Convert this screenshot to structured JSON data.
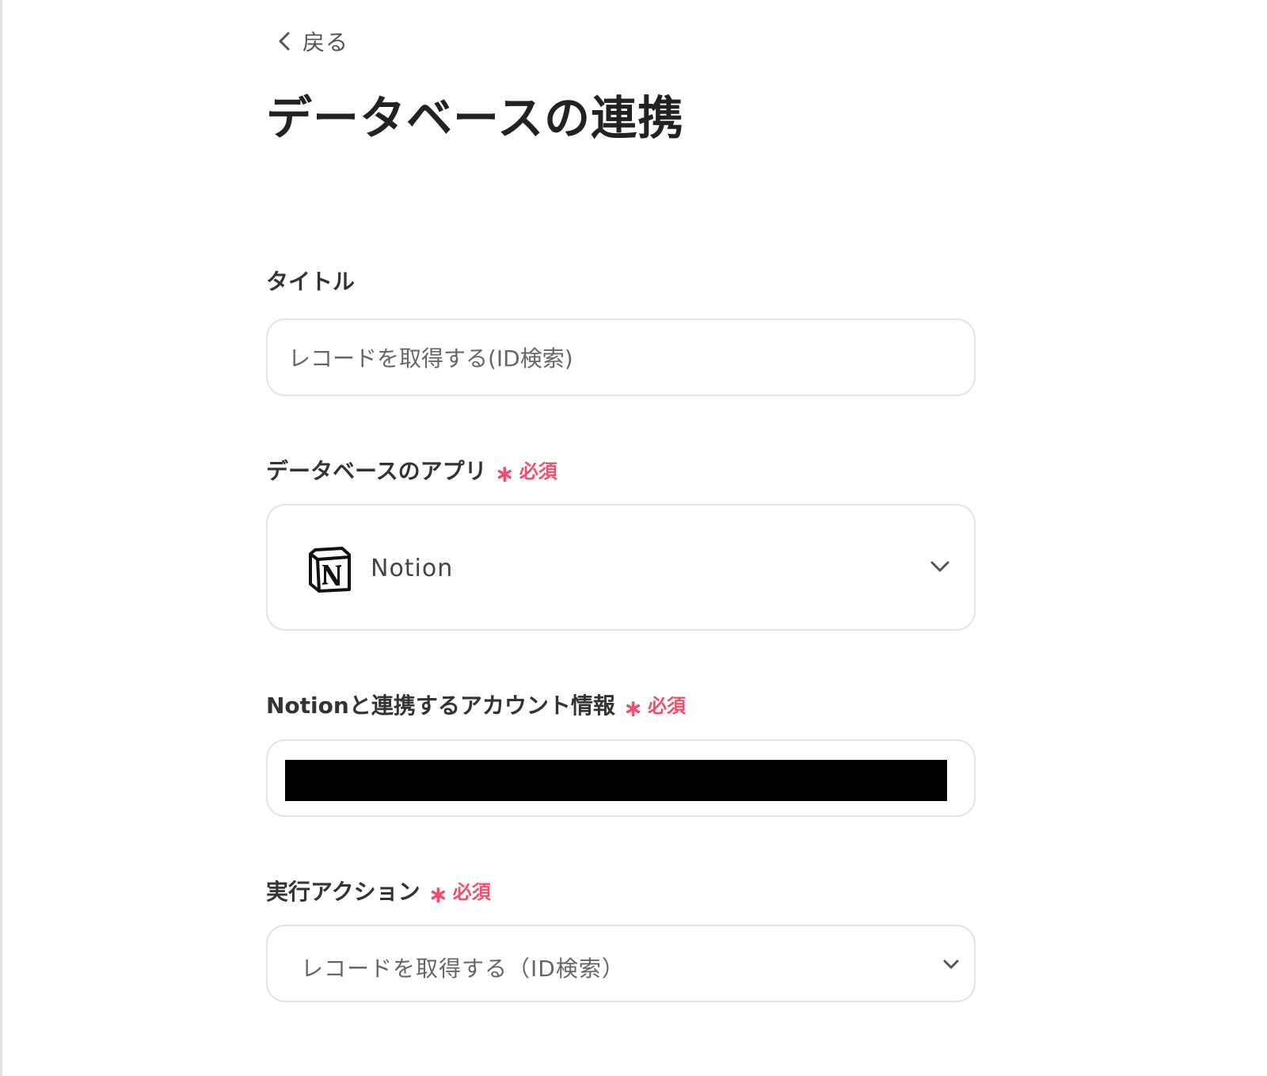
{
  "nav": {
    "back_label": "戻る"
  },
  "page": {
    "title": "データベースの連携"
  },
  "title_field": {
    "label": "タイトル",
    "value": "レコードを取得する(ID検索)"
  },
  "app_field": {
    "label": "データベースのアプリ",
    "required_label": "必須",
    "selected_app": "Notion",
    "app_icon": "notion-logo"
  },
  "account_field": {
    "label": "Notionと連携するアカウント情報",
    "required_label": "必須",
    "value_redacted": true
  },
  "action_field": {
    "label": "実行アクション",
    "required_label": "必須",
    "selected_value": "レコードを取得する（ID検索）"
  },
  "colors": {
    "required": "#f0506e",
    "border": "#e4e4e4",
    "text": "#333333"
  }
}
